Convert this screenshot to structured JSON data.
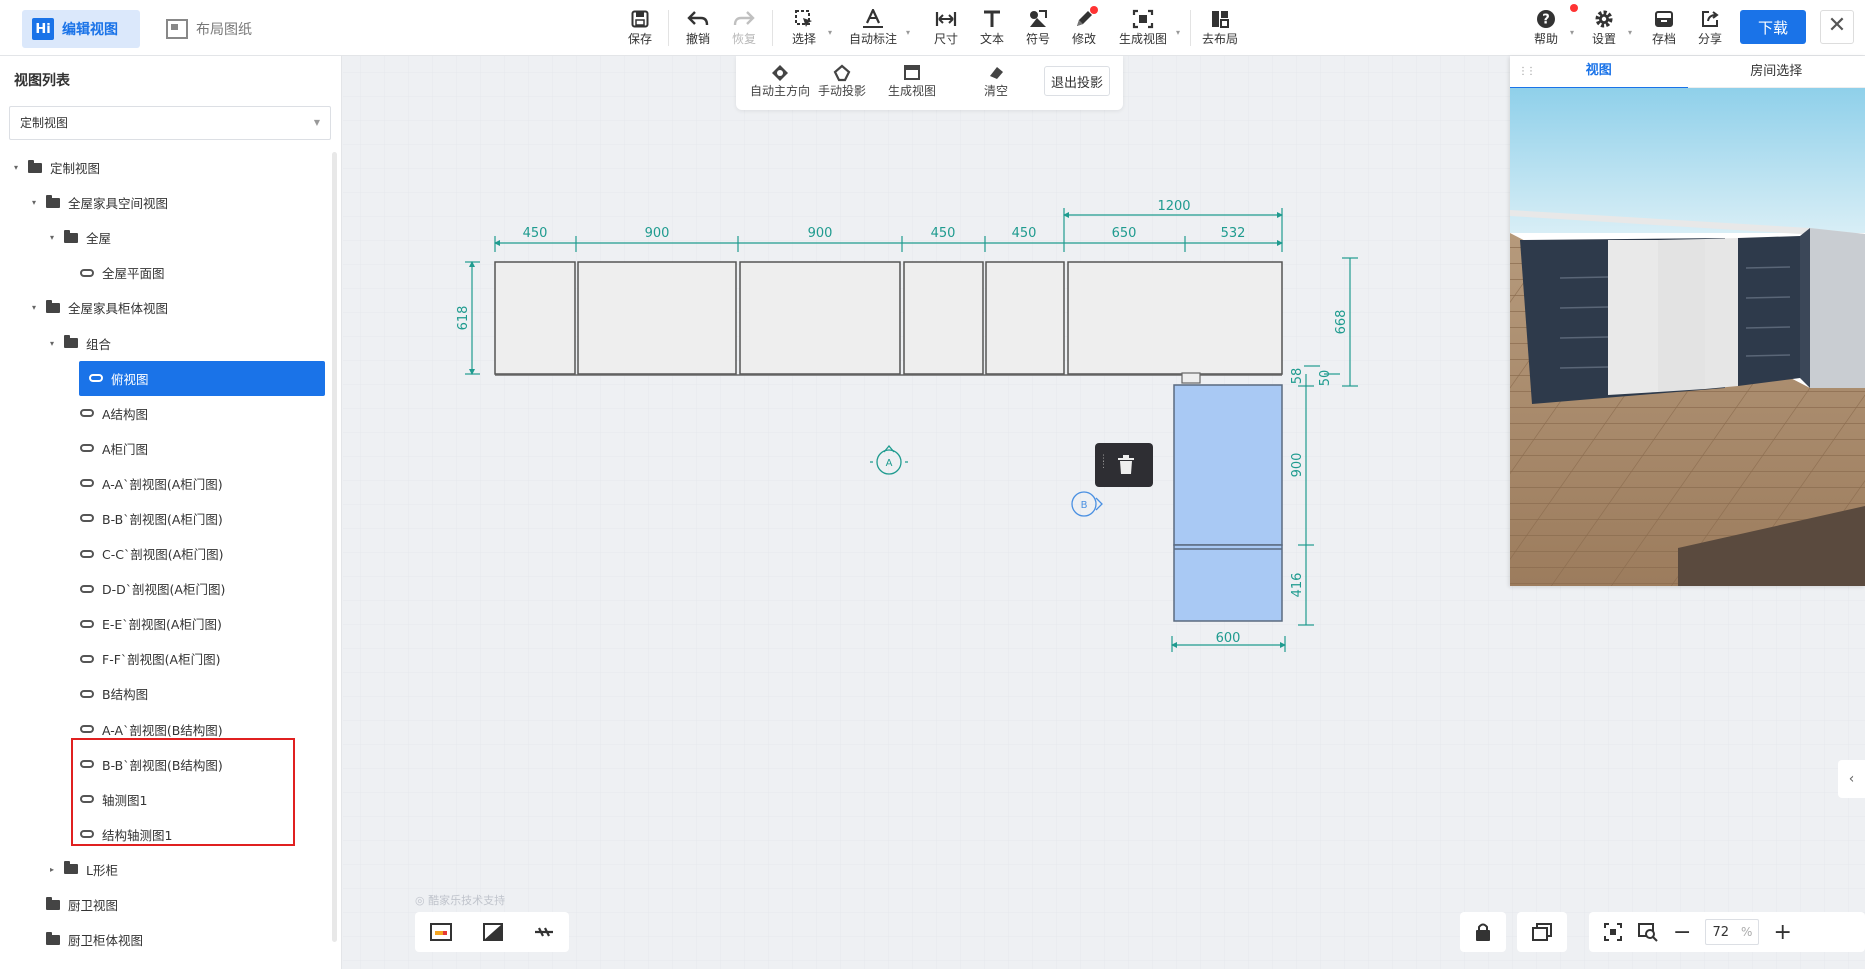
{
  "header": {
    "mode_tabs": [
      {
        "label": "编辑视图",
        "logo": "Hi",
        "active": true
      },
      {
        "label": "布局图纸",
        "active": false
      }
    ],
    "tools": [
      {
        "id": "save",
        "label": "保存",
        "icon": "save-icon"
      },
      {
        "id": "undo",
        "label": "撤销",
        "icon": "undo-icon"
      },
      {
        "id": "redo",
        "label": "恢复",
        "icon": "redo-icon",
        "disabled": true
      },
      {
        "id": "select",
        "label": "选择",
        "icon": "select-icon",
        "dropdown": true
      },
      {
        "id": "auto-dim",
        "label": "自动标注",
        "icon": "auto-annotate-icon",
        "dropdown": true
      },
      {
        "id": "dimension",
        "label": "尺寸",
        "icon": "dimension-icon"
      },
      {
        "id": "text",
        "label": "文本",
        "icon": "text-icon"
      },
      {
        "id": "symbol",
        "label": "符号",
        "icon": "symbol-icon"
      },
      {
        "id": "modify",
        "label": "修改",
        "icon": "pencil-icon",
        "badge": true
      },
      {
        "id": "gen-view",
        "label": "生成视图",
        "icon": "generate-view-icon",
        "dropdown": true
      },
      {
        "id": "goto-layout",
        "label": "去布局",
        "icon": "layout-icon"
      }
    ],
    "right_tools": [
      {
        "id": "help",
        "label": "帮助",
        "icon": "help-icon",
        "badge": true
      },
      {
        "id": "settings",
        "label": "设置",
        "icon": "gear-icon",
        "dropdown": true
      },
      {
        "id": "archive",
        "label": "存档",
        "icon": "archive-icon"
      },
      {
        "id": "share",
        "label": "分享",
        "icon": "share-icon"
      }
    ],
    "download_label": "下载",
    "close_glyph": "✕"
  },
  "left_panel": {
    "title": "视图列表",
    "select_value": "定制视图",
    "tree": [
      {
        "label": "定制视图",
        "level": 0,
        "type": "folder",
        "expanded": true
      },
      {
        "label": "全屋家具空间视图",
        "level": 1,
        "type": "folder",
        "expanded": true
      },
      {
        "label": "全屋",
        "level": 2,
        "type": "folder",
        "expanded": true
      },
      {
        "label": "全屋平面图",
        "level": 3,
        "type": "link"
      },
      {
        "label": "全屋家具柜体视图",
        "level": 1,
        "type": "folder",
        "expanded": true
      },
      {
        "label": "组合",
        "level": 2,
        "type": "folder",
        "expanded": true
      },
      {
        "label": "俯视图",
        "level": 3,
        "type": "link",
        "selected": true
      },
      {
        "label": "A结构图",
        "level": 3,
        "type": "link"
      },
      {
        "label": "A柜门图",
        "level": 3,
        "type": "link"
      },
      {
        "label": "A-A`剖视图(A柜门图)",
        "level": 3,
        "type": "link"
      },
      {
        "label": "B-B`剖视图(A柜门图)",
        "level": 3,
        "type": "link"
      },
      {
        "label": "C-C`剖视图(A柜门图)",
        "level": 3,
        "type": "link"
      },
      {
        "label": "D-D`剖视图(A柜门图)",
        "level": 3,
        "type": "link"
      },
      {
        "label": "E-E`剖视图(A柜门图)",
        "level": 3,
        "type": "link"
      },
      {
        "label": "F-F`剖视图(A柜门图)",
        "level": 3,
        "type": "link"
      },
      {
        "label": "B结构图",
        "level": 3,
        "type": "link"
      },
      {
        "label": "A-A`剖视图(B结构图)",
        "level": 3,
        "type": "link"
      },
      {
        "label": "B-B`剖视图(B结构图)",
        "level": 3,
        "type": "link"
      },
      {
        "label": "轴测图1",
        "level": 3,
        "type": "link"
      },
      {
        "label": "结构轴测图1",
        "level": 3,
        "type": "link"
      },
      {
        "label": "L形柜",
        "level": 2,
        "type": "folder",
        "expanded": false
      },
      {
        "label": "厨卫视图",
        "level": 1,
        "type": "folder"
      },
      {
        "label": "厨卫柜体视图",
        "level": 1,
        "type": "folder"
      }
    ]
  },
  "subtoolbar": {
    "items": [
      {
        "label": "自动主方向",
        "icon": "auto-direction-icon"
      },
      {
        "label": "手动投影",
        "icon": "manual-projection-icon"
      },
      {
        "label": "生成视图",
        "icon": "generate-view-icon",
        "dropdown": true
      },
      {
        "label": "清空",
        "icon": "eraser-icon",
        "dropdown": true
      }
    ],
    "exit_label": "退出投影"
  },
  "drawing": {
    "top_dims": [
      "450",
      "900",
      "900",
      "450",
      "450",
      "650",
      "532"
    ],
    "overall_dim": "1200",
    "left_dim": "618",
    "right_dims": [
      "668",
      "58",
      "50"
    ],
    "vertical_dims": [
      "900",
      "416"
    ],
    "bottom_dim": "600",
    "markers": [
      "A",
      "B"
    ],
    "accent": "#1f9b8f",
    "highlight_fill": "#a9c9f4"
  },
  "canvas": {
    "watermark": "酷家乐技术支持",
    "zoom_value": "72",
    "zoom_unit": "%"
  },
  "preview": {
    "tabs": [
      "视图",
      "房间选择"
    ],
    "active_tab": "视图"
  }
}
